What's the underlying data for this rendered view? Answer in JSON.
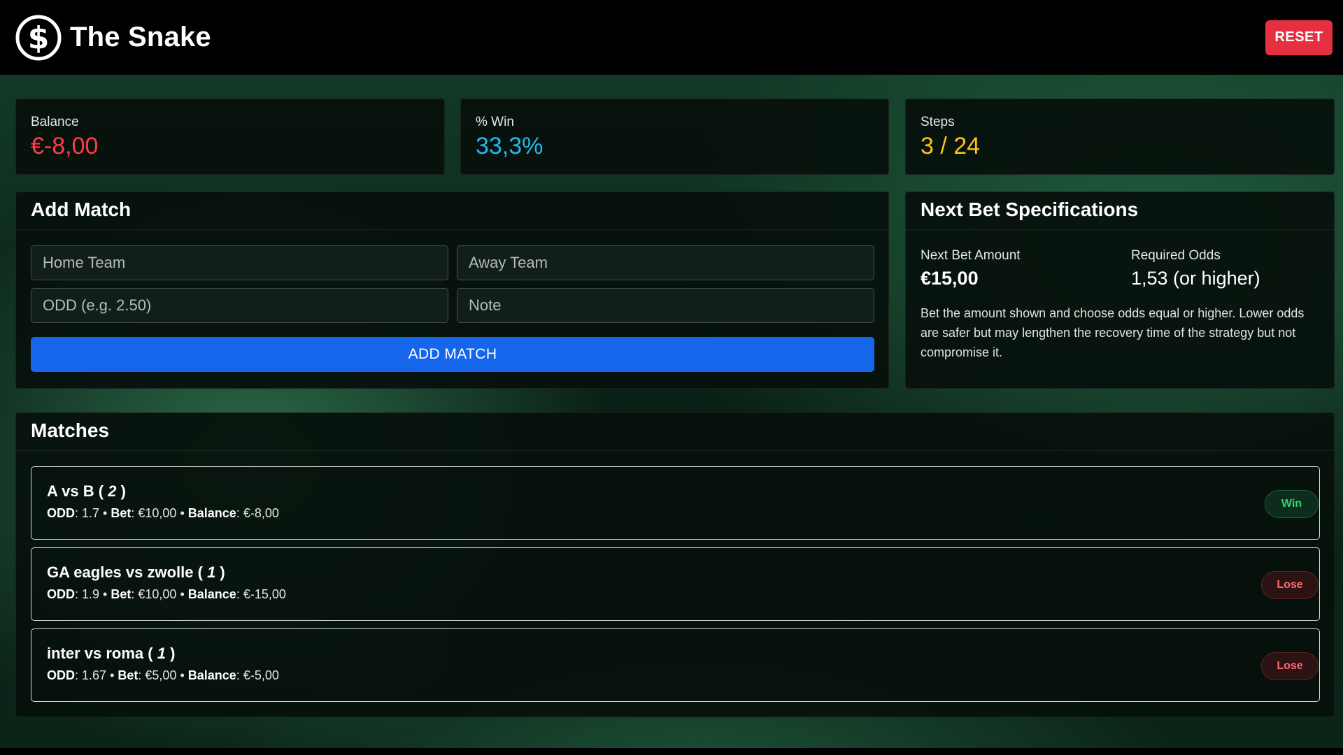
{
  "app": {
    "title": "The Snake",
    "reset_label": "RESET"
  },
  "stats": {
    "balance": {
      "label": "Balance",
      "value": "€-8,00",
      "color": "#ff3b4b"
    },
    "win_rate": {
      "label": "% Win",
      "value": "33,3%",
      "color": "#21b8f0"
    },
    "steps": {
      "label": "Steps",
      "value": "3 / 24",
      "color": "#ffbf1f"
    }
  },
  "add_match": {
    "title": "Add Match",
    "home_placeholder": "Home Team",
    "away_placeholder": "Away Team",
    "odd_placeholder": "ODD (e.g. 2.50)",
    "note_placeholder": "Note",
    "button_label": "ADD MATCH"
  },
  "next_bet": {
    "title": "Next Bet Specifications",
    "amount_label": "Next Bet Amount",
    "amount_value": "€15,00",
    "odds_label": "Required Odds",
    "odds_value": "1,53 (or higher)",
    "description": "Bet the amount shown and choose odds equal or higher. Lower odds are safer but may lengthen the recovery time of the strategy but not compromise it."
  },
  "matches": {
    "title": "Matches",
    "labels": {
      "odd": "ODD",
      "bet": "Bet",
      "balance": "Balance",
      "separator": " • "
    },
    "items": [
      {
        "teams": "A vs B",
        "selection": "2",
        "odd": "1.7",
        "bet": "€10,00",
        "balance": "€-8,00",
        "result": "Win"
      },
      {
        "teams": "GA eagles vs zwolle",
        "selection": "1",
        "odd": "1.9",
        "bet": "€10,00",
        "balance": "€-15,00",
        "result": "Lose"
      },
      {
        "teams": "inter vs roma",
        "selection": "1",
        "odd": "1.67",
        "bet": "€5,00",
        "balance": "€-5,00",
        "result": "Lose"
      }
    ]
  },
  "icons": {
    "logo": "dollar-coin-icon"
  }
}
